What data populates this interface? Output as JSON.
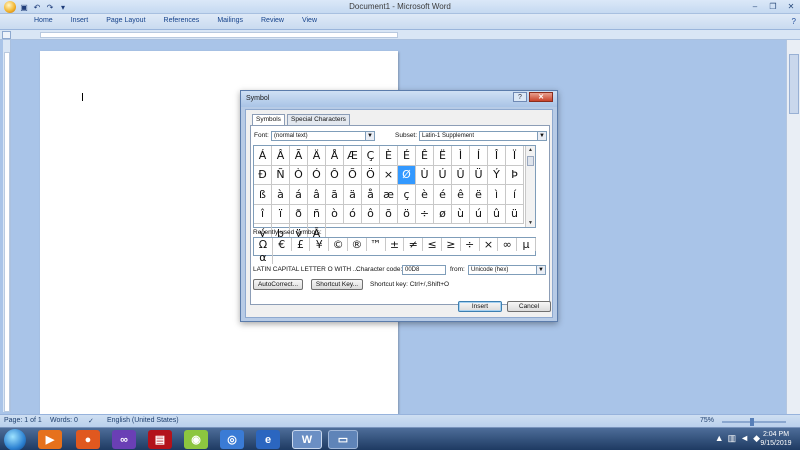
{
  "window": {
    "title": "Document1 - Microsoft Word",
    "controls": [
      "–",
      "❐",
      "✕"
    ]
  },
  "ribbon": {
    "tabs": [
      "Home",
      "Insert",
      "Page Layout",
      "References",
      "Mailings",
      "Review",
      "View"
    ],
    "help_icon": "?"
  },
  "status_bar": {
    "page": "Page: 1 of 1",
    "words": "Words: 0",
    "language": "English (United States)",
    "zoom": "75%"
  },
  "taskbar": {
    "time": "2:04 PM",
    "date": "9/15/2019",
    "apps": [
      "media-player",
      "firefox",
      "visual-studio",
      "winrar",
      "synology",
      "chrome",
      "internet-explorer",
      "word",
      "other"
    ]
  },
  "dialog": {
    "title": "Symbol",
    "tabs": [
      "Symbols",
      "Special Characters"
    ],
    "font_label": "Font:",
    "font_value": "(normal text)",
    "subset_label": "Subset:",
    "subset_value": "Latin-1 Supplement",
    "symbol_grid": [
      [
        "Á",
        "Â",
        "Ã",
        "Ä",
        "Å",
        "Æ",
        "Ç",
        "È",
        "É",
        "Ê",
        "Ë",
        "Ì",
        "Í",
        "Î",
        "Ï"
      ],
      [
        "Ð",
        "Ñ",
        "Ò",
        "Ó",
        "Ô",
        "Õ",
        "Ö",
        "×",
        "Ø",
        "Ù",
        "Ú",
        "Û",
        "Ü",
        "Ý",
        "Þ"
      ],
      [
        "ß",
        "à",
        "á",
        "â",
        "ã",
        "ä",
        "å",
        "æ",
        "ç",
        "è",
        "é",
        "ê",
        "ë",
        "ì",
        "í"
      ],
      [
        "î",
        "ï",
        "ð",
        "ñ",
        "ò",
        "ó",
        "ô",
        "õ",
        "ö",
        "÷",
        "ø",
        "ù",
        "ú",
        "û",
        "ü"
      ],
      [
        "ý",
        "þ",
        "ÿ",
        "Ā"
      ]
    ],
    "selected_symbol": "Ø",
    "recent_label": "Recently used symbols:",
    "recent_symbols": [
      "Ω",
      "€",
      "£",
      "¥",
      "©",
      "®",
      "™",
      "±",
      "≠",
      "≤",
      "≥",
      "÷",
      "×",
      "∞",
      "µ",
      "α"
    ],
    "char_name": "LATIN CAPITAL LETTER O WITH ...",
    "char_code_label": "Character code:",
    "char_code_value": "00D8",
    "from_label": "from:",
    "from_value": "Unicode (hex)",
    "autocorrect_button": "AutoCorrect...",
    "shortcut_key_button": "Shortcut Key...",
    "shortcut_text": "Shortcut key: Ctrl+/,Shift+O",
    "insert_button": "Insert",
    "cancel_button": "Cancel"
  }
}
